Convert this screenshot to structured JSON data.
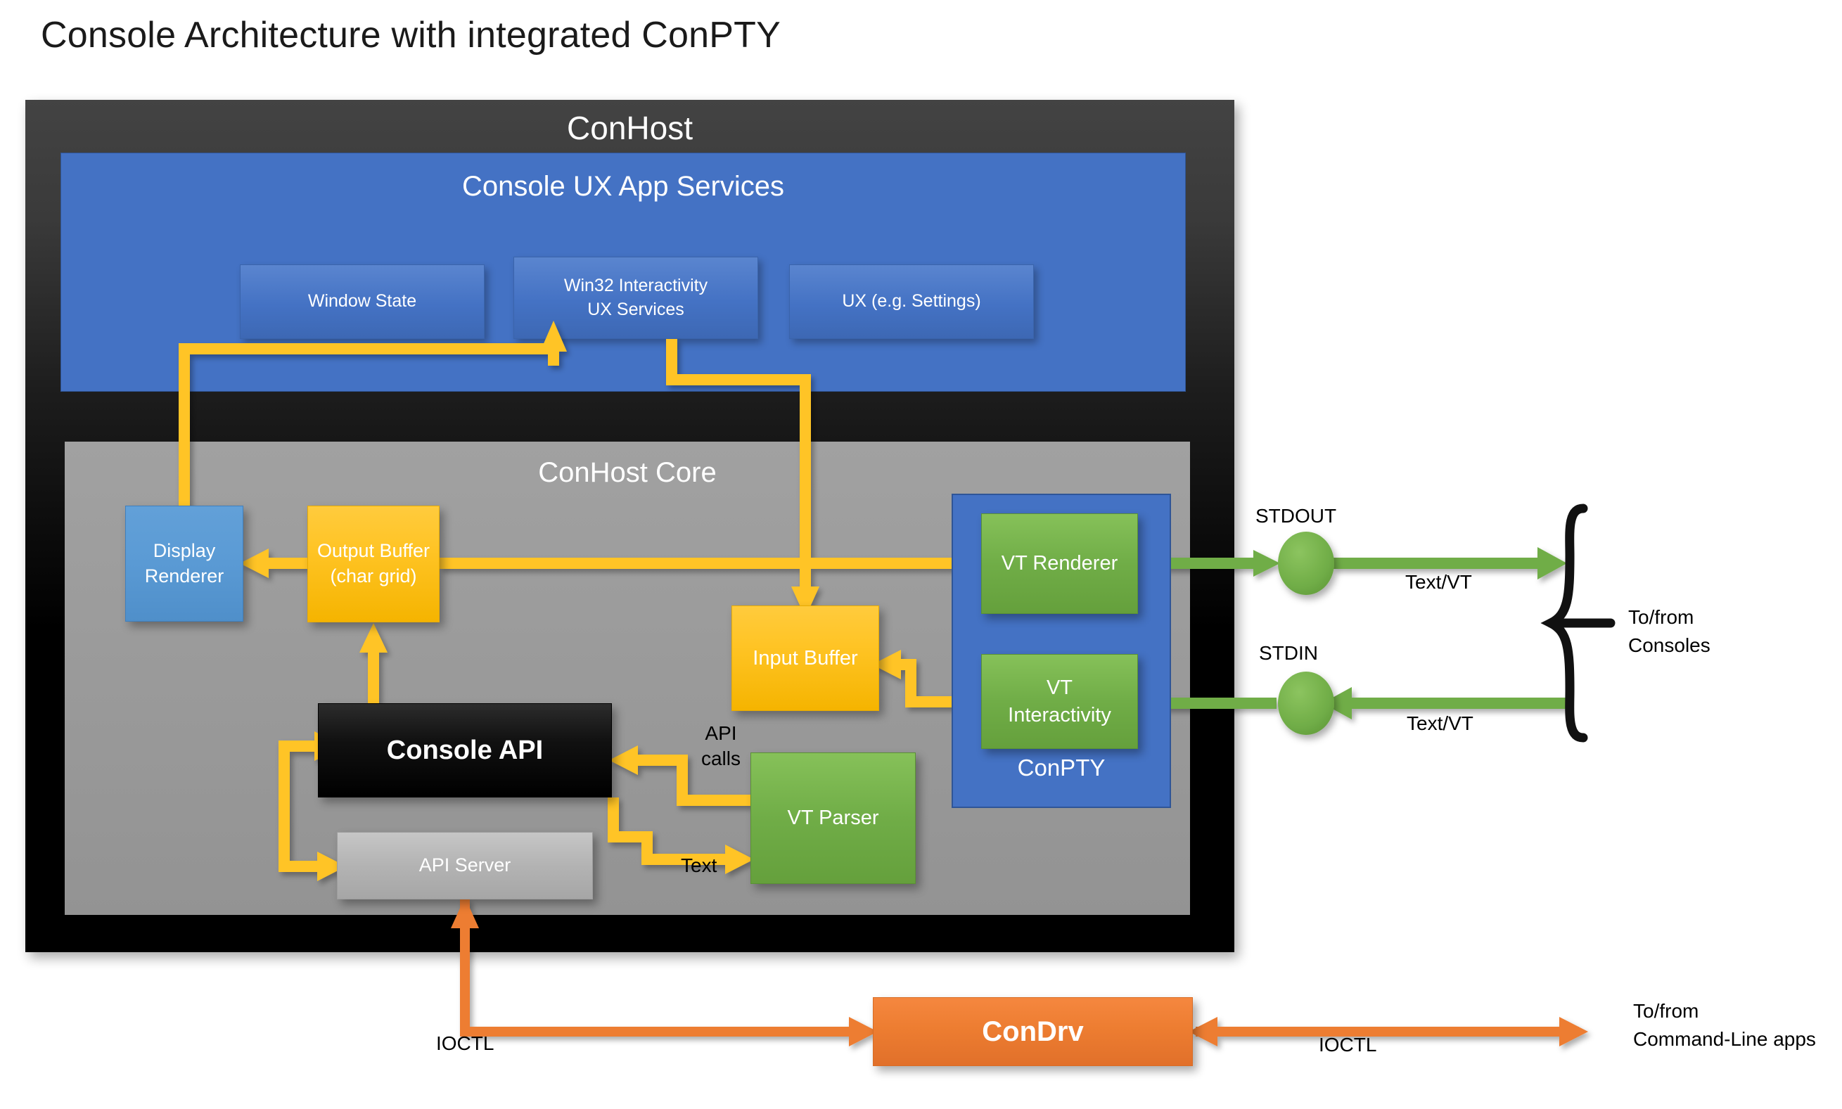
{
  "title": "Console Architecture with integrated ConPTY",
  "conhost": {
    "title": "ConHost",
    "ux_services": {
      "title": "Console UX App Services",
      "boxes": [
        {
          "label": "Window State"
        },
        {
          "label": "Win32 Interactivity\nUX Services"
        },
        {
          "label": "UX (e.g. Settings)"
        }
      ]
    },
    "core": {
      "title": "ConHost Core",
      "nodes": {
        "display_renderer": "Display\nRenderer",
        "output_buffer": "Output Buffer\n(char grid)",
        "input_buffer": "Input Buffer",
        "console_api": "Console API",
        "api_server": "API Server",
        "vt_parser": "VT Parser"
      },
      "conpty": {
        "title": "ConPTY",
        "vt_renderer": "VT Renderer",
        "vt_interactivity": "VT\nInteractivity"
      },
      "edge_labels": {
        "api_calls": "API\ncalls",
        "text": "Text"
      }
    }
  },
  "streams": {
    "stdout_label": "STDOUT",
    "stdin_label": "STDIN",
    "out_node": "OUT",
    "in_node": "IN",
    "out_text_label": "Text/VT",
    "in_text_label": "Text/VT",
    "bracket_label": "To/from\nConsoles"
  },
  "condrv": {
    "label": "ConDrv",
    "ioctl_left": "IOCTL",
    "ioctl_right": "IOCTL",
    "target_label": "To/from\nCommand-Line apps"
  },
  "colors": {
    "conhost_dark": "#1d1d1d",
    "ux_blue": "#4472c4",
    "core_gray": "#9a9a9a",
    "node_blue": "#5b9bd5",
    "node_amber": "#ffc425",
    "node_green": "#70ad47",
    "node_gray": "#b3b3b3",
    "node_black": "#000000",
    "condrv_orange": "#ed7d31",
    "arrow_amber": "#ffc425",
    "arrow_green": "#70ad47",
    "arrow_orange": "#ed7d31",
    "text_white": "#ffffff",
    "text_black": "#000000"
  }
}
